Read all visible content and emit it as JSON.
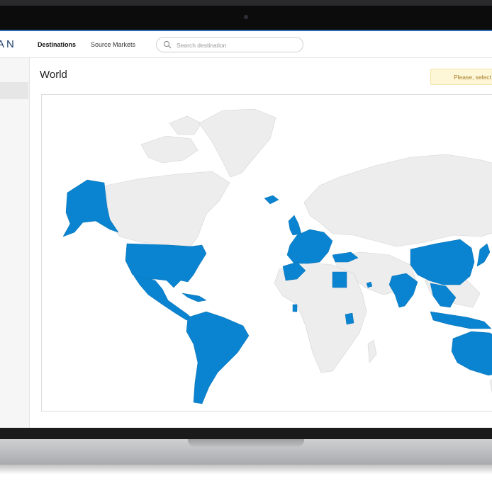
{
  "app": {
    "logo_text": "AN"
  },
  "nav": {
    "destinations_label": "Destinations",
    "source_markets_label": "Source Markets"
  },
  "search": {
    "placeholder": "Search destination",
    "icon": "search-icon"
  },
  "page": {
    "title": "World"
  },
  "alert": {
    "text": "Please, select"
  },
  "map": {
    "highlight_color": "#0a84d0",
    "base_color": "#ededed",
    "highlighted_regions": [
      "Alaska",
      "United States",
      "Mexico",
      "Central America",
      "Caribbean",
      "South America",
      "United Kingdom",
      "Western Europe",
      "Italy",
      "Turkey",
      "Morocco",
      "Egypt",
      "UAE",
      "Ghana",
      "Kenya",
      "India",
      "China",
      "Southeast Asia",
      "Japan",
      "Indonesia",
      "Australia"
    ]
  }
}
